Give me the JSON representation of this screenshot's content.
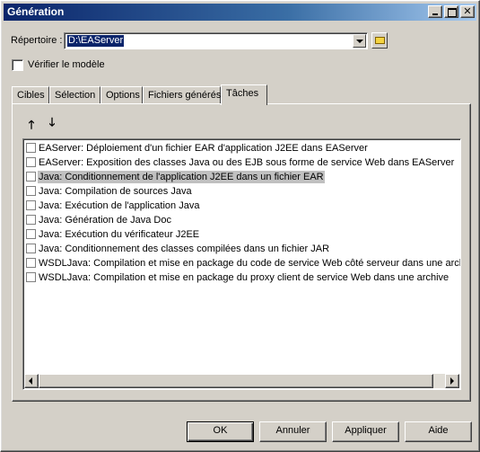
{
  "window": {
    "title": "Génération",
    "minimize_icon": "minimize-icon",
    "maximize_icon": "maximize-icon",
    "close_glyph": "✕"
  },
  "directory": {
    "label": "Répertoire :",
    "value": "D:\\EAServer",
    "folder_icon": "folder-icon"
  },
  "verify_model": {
    "label": "Vérifier le modèle",
    "checked": false
  },
  "tabs": [
    {
      "label": "Cibles"
    },
    {
      "label": "Sélection"
    },
    {
      "label": "Options"
    },
    {
      "label": "Fichiers générés"
    },
    {
      "label": "Tâches",
      "active": true
    }
  ],
  "move_up_glyph": "🡑",
  "move_down_glyph": "🡓",
  "tasks": [
    {
      "label": "EAServer: Déploiement d'un fichier EAR d'application J2EE dans EAServer",
      "checked": false
    },
    {
      "label": "EAServer: Exposition des classes Java ou des EJB sous forme de service Web dans EAServer",
      "checked": false
    },
    {
      "label": "Java: Conditionnement de l'application J2EE dans un fichier EAR",
      "checked": false,
      "selected": true
    },
    {
      "label": "Java: Compilation de sources Java",
      "checked": false
    },
    {
      "label": "Java: Exécution de l'application Java",
      "checked": false
    },
    {
      "label": "Java: Génération de Java Doc",
      "checked": false
    },
    {
      "label": "Java: Exécution du vérificateur J2EE",
      "checked": false
    },
    {
      "label": "Java: Conditionnement des classes compilées dans un fichier JAR",
      "checked": false
    },
    {
      "label": "WSDLJava: Compilation et mise en package du code de service Web côté serveur dans une archive",
      "checked": false
    },
    {
      "label": "WSDLJava: Compilation et mise en package du proxy client de service Web dans une archive",
      "checked": false
    }
  ],
  "buttons": {
    "ok": "OK",
    "cancel": "Annuler",
    "apply": "Appliquer",
    "help": "Aide"
  }
}
